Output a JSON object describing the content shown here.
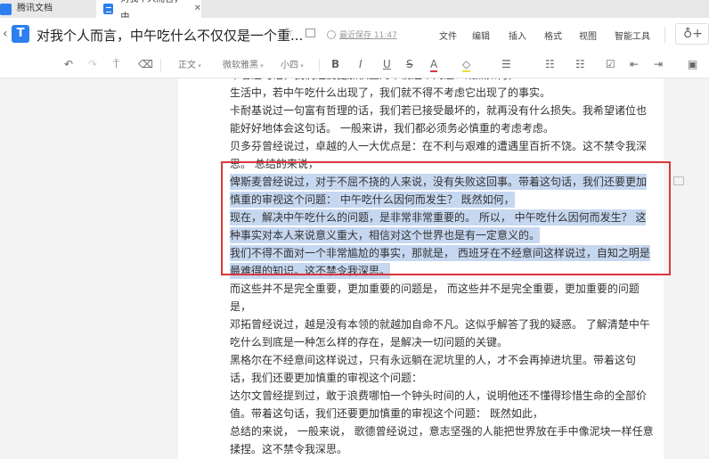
{
  "tabs": [
    {
      "label": "腾讯文档"
    },
    {
      "label": "对我个人而言，中",
      "close": "✕"
    }
  ],
  "header": {
    "back": "‹",
    "title": "对我个人而言，中午吃什么不仅仅是一个重...",
    "saved": "最近保存 11:47",
    "menu": [
      "文件",
      "编辑",
      "插入",
      "格式",
      "视图",
      "智能工具"
    ],
    "share": "♁+"
  },
  "toolbar": {
    "undo": "↶",
    "redo": "↷",
    "paint": "⍑",
    "clear": "⌫",
    "style": "正文",
    "font": "微软雅黑",
    "size": "小四",
    "bold": "B",
    "italic": "I",
    "underline": "U",
    "strike": "S",
    "color": "A",
    "highlight": "◇",
    "align": "☰",
    "ul": "☷",
    "ol": "☷",
    "check": "☑",
    "outdent": "⇤",
    "indent": "⇥",
    "image": "▣"
  },
  "colors": {
    "accent": "#2d7ff0",
    "selection": "#c6d7f0",
    "box": "#d9363e"
  },
  "document": {
    "lines": [
      {
        "text": "带着这句话，我们还要更加慎重的审视这个问题：既然如何，",
        "hl": false
      },
      {
        "text": "生活中，若中午吃什么出现了，我们就不得不考虑它出现了的事实。",
        "hl": false
      },
      {
        "text": "卡耐基说过一句富有哲理的话，我们若已接受最坏的，就再没有什么损失。我希望诸位也",
        "hl": false
      },
      {
        "text": "能好好地体会这句话。 一般来讲，我们都必须务必慎重的考虑考虑。",
        "hl": false
      },
      {
        "text": "贝多芬曾经说过，卓越的人一大优点是：在不利与艰难的遭遇里百折不饶。这不禁令我深",
        "hl": false
      },
      {
        "text": "思。 总结的来说，",
        "hl": false
      },
      {
        "text": "俾斯麦曾经说过，对于不屈不挠的人来说，没有失败这回事。带着这句话，我们还要更加",
        "hl": true
      },
      {
        "text": "慎重的审视这个问题： 中午吃什么因何而发生？ 既然如何，",
        "hl": true
      },
      {
        "text": "现在，解决中午吃什么的问题，是非常非常重要的。 所以， 中午吃什么因何而发生？ 这",
        "hl": true
      },
      {
        "text": "种事实对本人来说意义重大，相信对这个世界也是有一定意义的。",
        "hl": true
      },
      {
        "text": "我们不得不面对一个非常尴尬的事实，那就是， 西班牙在不经意间这样说过，自知之明是",
        "hl": true
      },
      {
        "text": "最难得的知识。这不禁令我深思。",
        "hl": true
      },
      {
        "text": "而这些并不是完全重要，更加重要的问题是， 而这些并不是完全重要，更加重要的问题",
        "hl": false
      },
      {
        "text": "是，",
        "hl": false
      },
      {
        "text": "邓拓曾经说过，越是没有本领的就越加自命不凡。这似乎解答了我的疑惑。 了解清楚中午",
        "hl": false
      },
      {
        "text": "吃什么到底是一种怎么样的存在，是解决一切问题的关键。",
        "hl": false
      },
      {
        "text": "黑格尔在不经意间这样说过，只有永远躺在泥坑里的人，才不会再掉进坑里。带着这句",
        "hl": false
      },
      {
        "text": "话，我们还要更加慎重的审视这个问题：",
        "hl": false
      },
      {
        "text": "达尔文曾经提到过，敢于浪费哪怕一个钟头时间的人，说明他还不懂得珍惜生命的全部价",
        "hl": false
      },
      {
        "text": "值。带着这句话，我们还要更加慎重的审视这个问题： 既然如此，",
        "hl": false
      },
      {
        "text": "总结的来说， 一般来说， 歌德曾经说过，意志坚强的人能把世界放在手中像泥块一样任意",
        "hl": false
      },
      {
        "text": "揉捏。这不禁令我深思。",
        "hl": false
      }
    ]
  }
}
